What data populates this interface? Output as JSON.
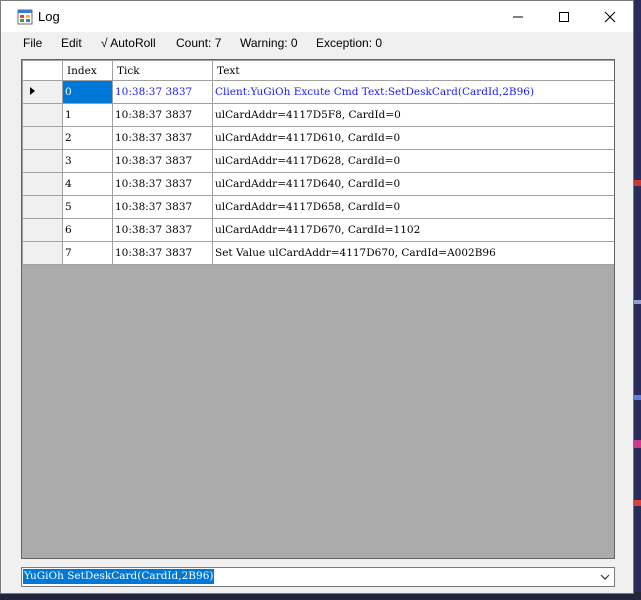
{
  "window": {
    "title": "Log"
  },
  "menu": {
    "file": "File",
    "edit": "Edit",
    "autoroll": "√ AutoRoll",
    "count": "Count: 7",
    "warning": "Warning: 0",
    "exception": "Exception: 0"
  },
  "grid": {
    "columns": [
      "Index",
      "Tick",
      "Text"
    ],
    "rows": [
      {
        "index": "0",
        "tick": "10:38:37 3837",
        "text": "Client:YuGiOh Excute Cmd Text:SetDeskCard(CardId,2B96)"
      },
      {
        "index": "1",
        "tick": "10:38:37 3837",
        "text": "ulCardAddr=4117D5F8, CardId=0"
      },
      {
        "index": "2",
        "tick": "10:38:37 3837",
        "text": "ulCardAddr=4117D610, CardId=0"
      },
      {
        "index": "3",
        "tick": "10:38:37 3837",
        "text": "ulCardAddr=4117D628, CardId=0"
      },
      {
        "index": "4",
        "tick": "10:38:37 3837",
        "text": "ulCardAddr=4117D640, CardId=0"
      },
      {
        "index": "5",
        "tick": "10:38:37 3837",
        "text": "ulCardAddr=4117D658, CardId=0"
      },
      {
        "index": "6",
        "tick": "10:38:37 3837",
        "text": "ulCardAddr=4117D670, CardId=1102"
      },
      {
        "index": "7",
        "tick": "10:38:37 3837",
        "text": "Set Value ulCardAddr=4117D670, CardId=A002B96"
      }
    ]
  },
  "command": {
    "value": "YuGiOh SetDeskCard(CardId,2B96)"
  },
  "colors": {
    "selection": "#0078d7",
    "selected_text": "#1a1aff",
    "grid_background": "#ababab"
  }
}
